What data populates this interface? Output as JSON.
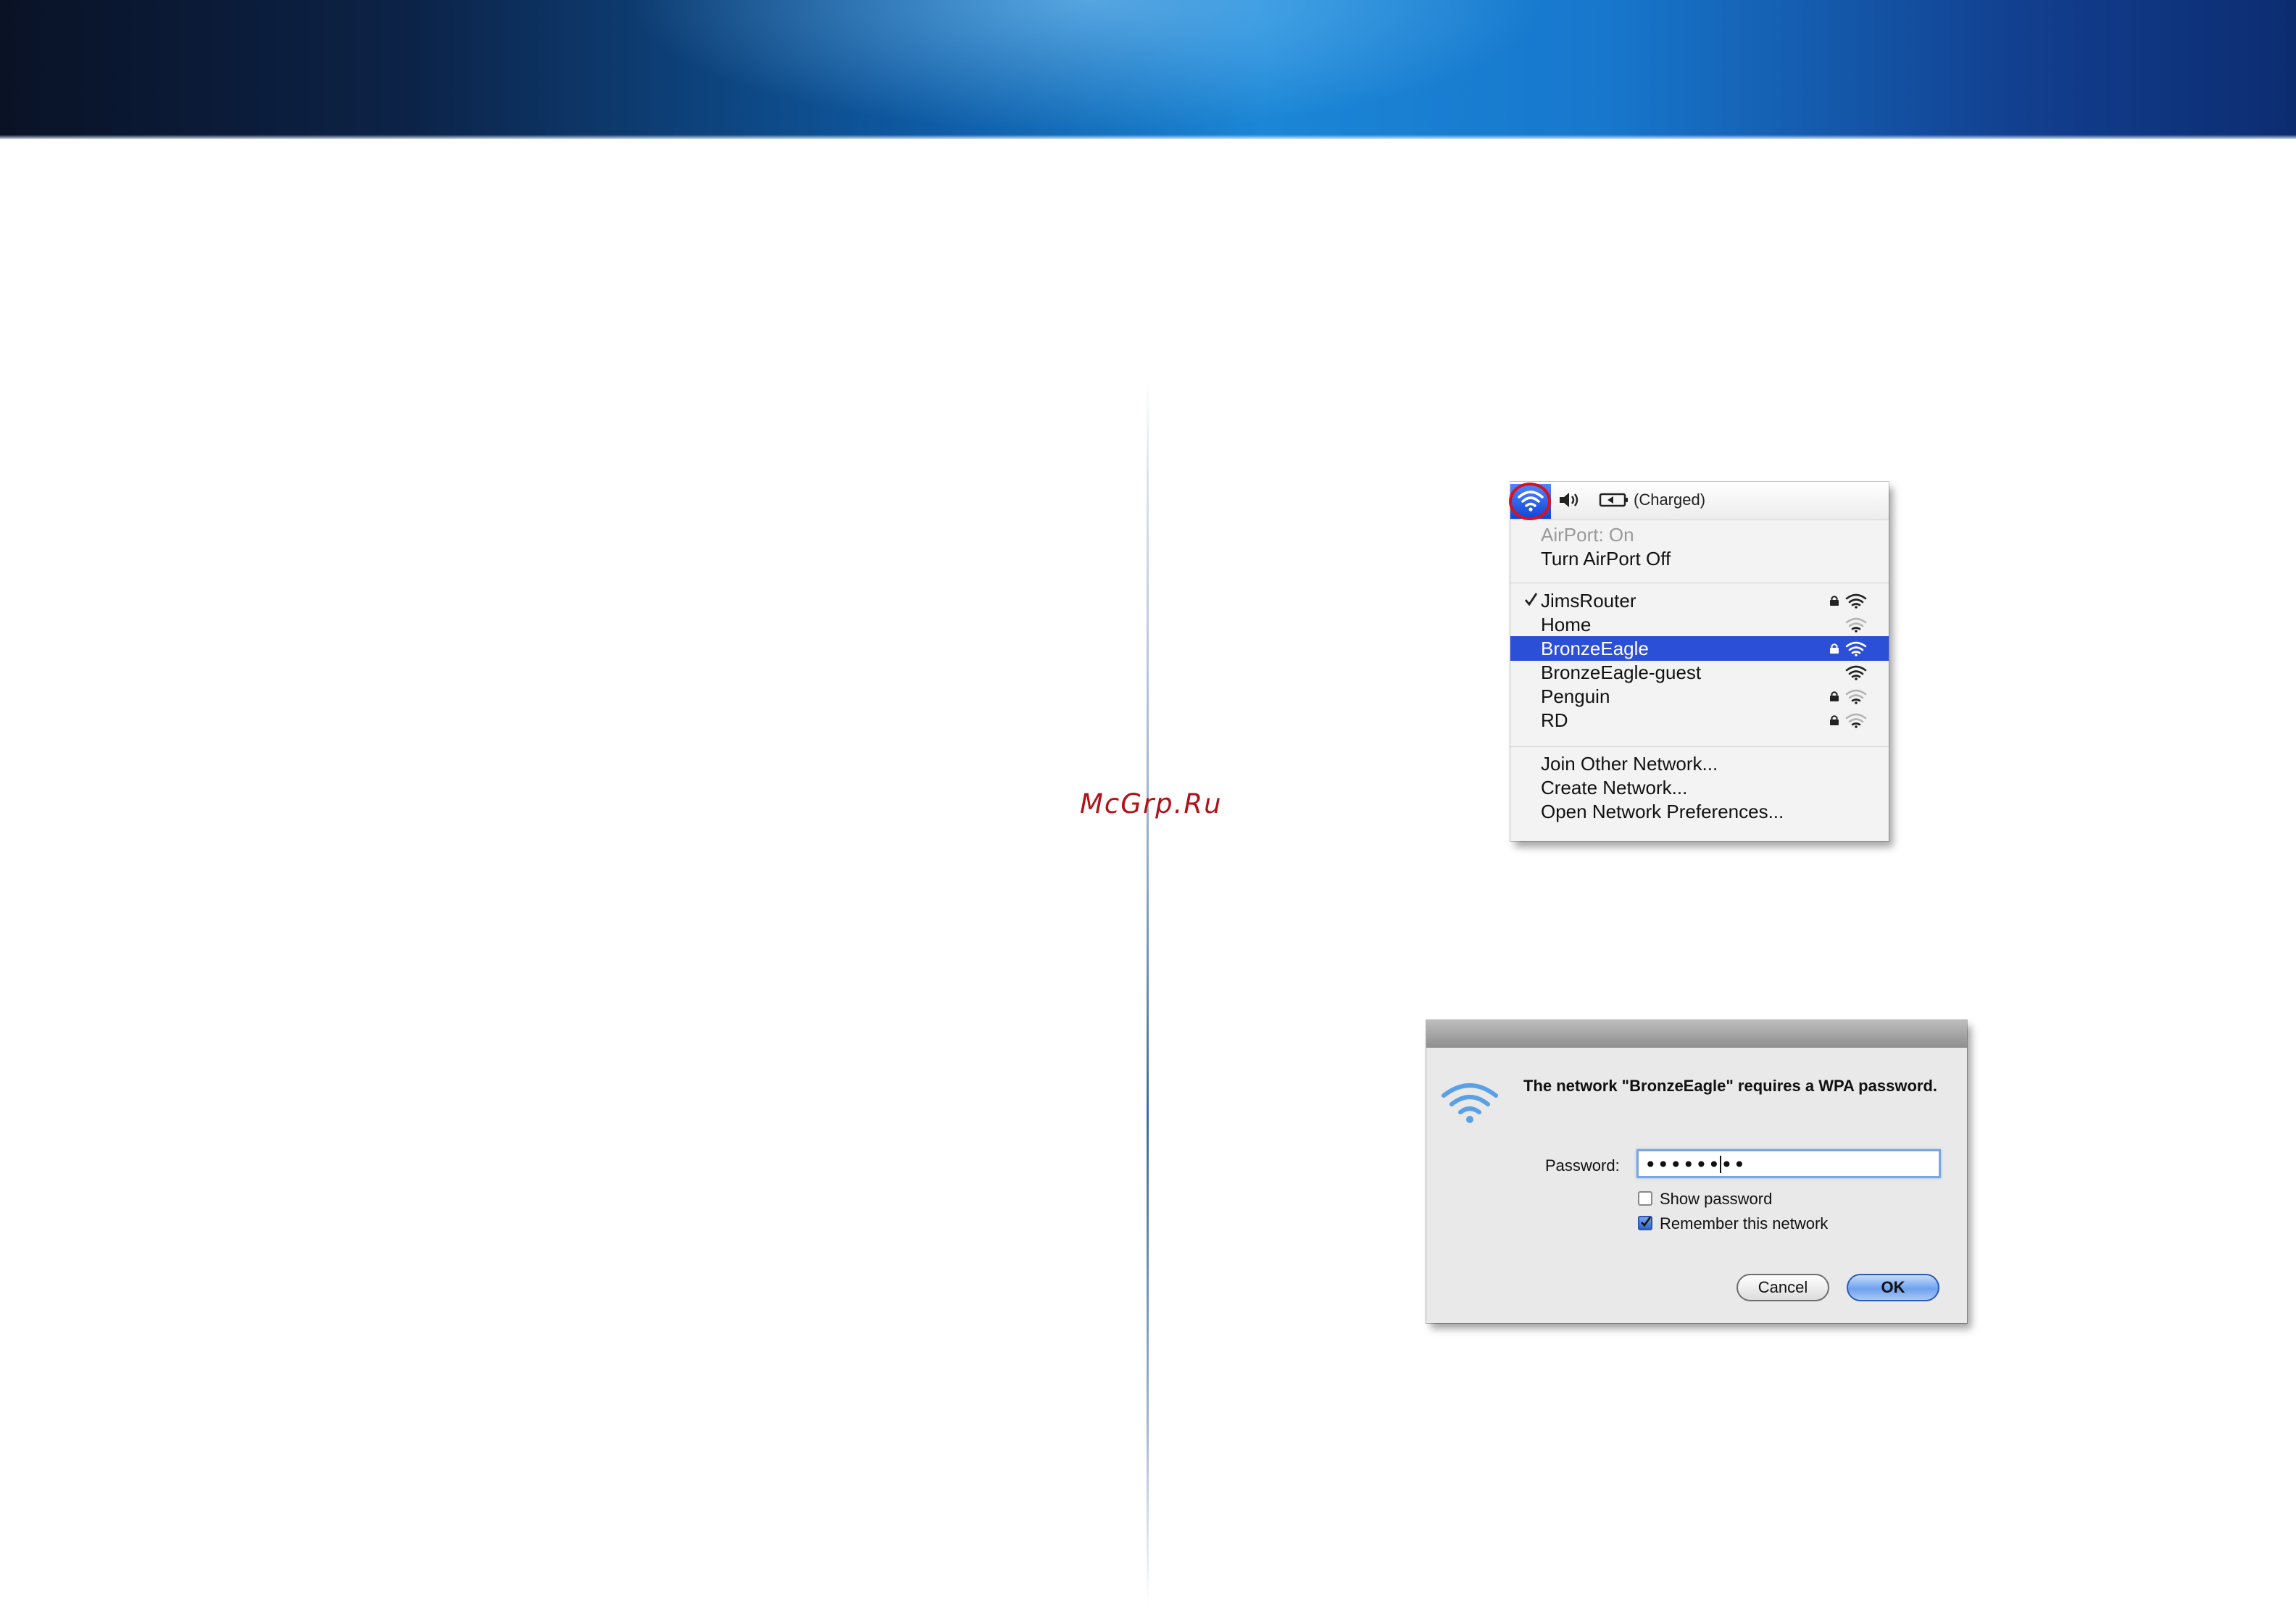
{
  "watermark": "McGrp.Ru",
  "menu": {
    "battery_status": "(Charged)",
    "airport_status": "AirPort: On",
    "turn_off": "Turn AirPort Off",
    "networks": [
      {
        "name": "JimsRouter",
        "checked": true,
        "locked": true,
        "signal": "strong",
        "selected": false
      },
      {
        "name": "Home",
        "checked": false,
        "locked": false,
        "signal": "weak",
        "selected": false
      },
      {
        "name": "BronzeEagle",
        "checked": false,
        "locked": true,
        "signal": "strong",
        "selected": true
      },
      {
        "name": "BronzeEagle-guest",
        "checked": false,
        "locked": false,
        "signal": "strong",
        "selected": false
      },
      {
        "name": "Penguin",
        "checked": false,
        "locked": true,
        "signal": "weak",
        "selected": false
      },
      {
        "name": "RD",
        "checked": false,
        "locked": true,
        "signal": "weak",
        "selected": false
      }
    ],
    "join_other": "Join Other Network...",
    "create": "Create Network...",
    "prefs": "Open Network Preferences..."
  },
  "dialog": {
    "message": "The network \"BronzeEagle\" requires a WPA password.",
    "password_label": "Password:",
    "password_value": "••••••••",
    "show_password": "Show password",
    "show_password_checked": false,
    "remember": "Remember this network",
    "remember_checked": true,
    "cancel": "Cancel",
    "ok": "OK"
  },
  "colors": {
    "selection": "#2c4fd8",
    "highlight_ring": "#d8111f",
    "watermark": "#b0131a"
  }
}
